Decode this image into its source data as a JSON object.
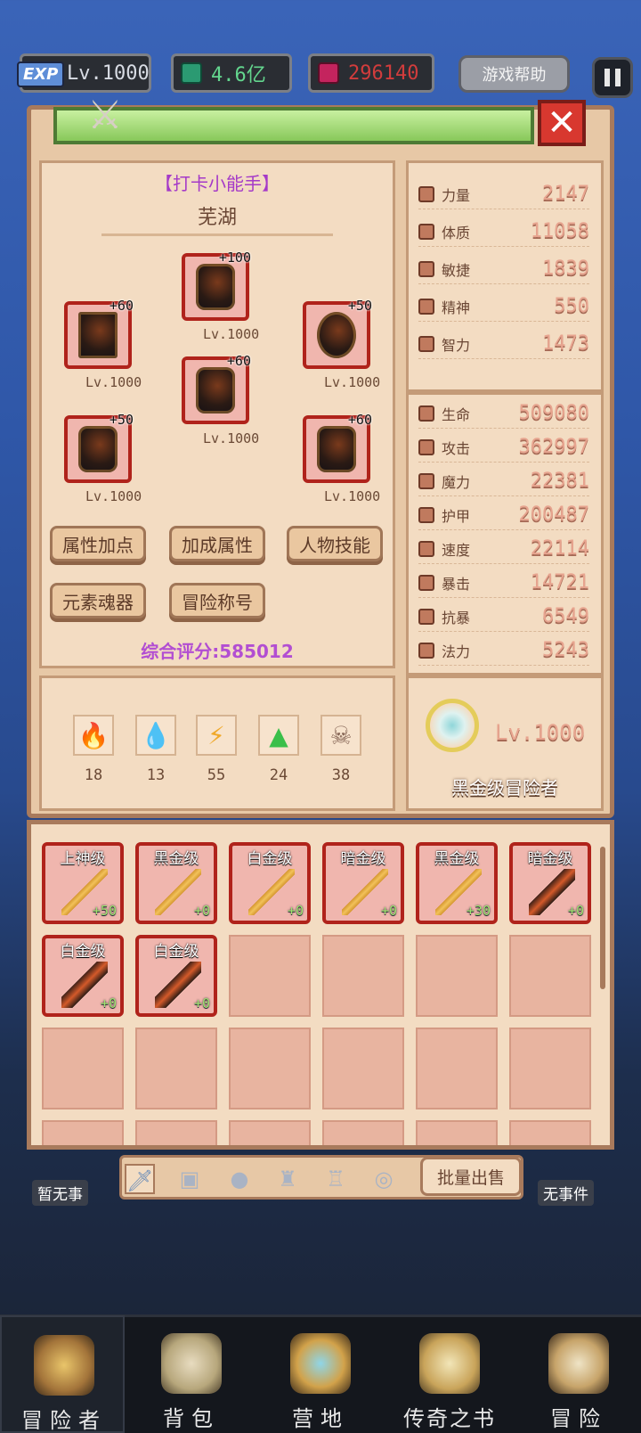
{
  "topbar": {
    "exp_badge": "EXP",
    "level": "Lv.1000",
    "currency1": "4.6亿",
    "currency2": "296140",
    "help_label": "游戏帮助"
  },
  "colors": {
    "accent_red": "#b0231b",
    "stat_value": "#e7a48f",
    "title_purple": "#a53ac8",
    "green_plus": "#9ee36f"
  },
  "player": {
    "title": "【打卡小能手】",
    "name": "芜湖",
    "score_label": "综合评分:585012"
  },
  "equipment": [
    {
      "plus": "+100",
      "level": "Lv.1000"
    },
    {
      "plus": "+60",
      "level": "Lv.1000"
    },
    {
      "plus": "+50",
      "level": "Lv.1000"
    },
    {
      "plus": "+60",
      "level": "Lv.1000"
    },
    {
      "plus": "+50",
      "level": "Lv.1000"
    },
    {
      "plus": "+60",
      "level": "Lv.1000"
    }
  ],
  "buttons": {
    "attr_points": "属性加点",
    "bonus_attr": "加成属性",
    "char_skill": "人物技能",
    "element_soul": "元素魂器",
    "adventure_title": "冒险称号"
  },
  "base_stats": [
    {
      "label": "力量",
      "value": "2147"
    },
    {
      "label": "体质",
      "value": "11058"
    },
    {
      "label": "敏捷",
      "value": "1839"
    },
    {
      "label": "精神",
      "value": "550"
    },
    {
      "label": "智力",
      "value": "1473"
    }
  ],
  "combat_stats": [
    {
      "label": "生命",
      "value": "509080"
    },
    {
      "label": "攻击",
      "value": "362997"
    },
    {
      "label": "魔力",
      "value": "22381"
    },
    {
      "label": "护甲",
      "value": "200487"
    },
    {
      "label": "速度",
      "value": "22114"
    },
    {
      "label": "暴击",
      "value": "14721"
    },
    {
      "label": "抗暴",
      "value": "6549"
    },
    {
      "label": "法力",
      "value": "5243"
    }
  ],
  "elements": [
    {
      "icon": "fire-icon",
      "count": "18"
    },
    {
      "icon": "water-icon",
      "count": "13"
    },
    {
      "icon": "lightning-icon",
      "count": "55"
    },
    {
      "icon": "earth-icon",
      "count": "24"
    },
    {
      "icon": "skull-icon",
      "count": "38"
    }
  ],
  "rank": {
    "level": "Lv.1000",
    "name": "黑金级冒险者"
  },
  "inventory": [
    {
      "grade": "上神级",
      "plus": "+50",
      "type": "gold"
    },
    {
      "grade": "黑金级",
      "plus": "+0",
      "type": "gold"
    },
    {
      "grade": "白金级",
      "plus": "+0",
      "type": "gold"
    },
    {
      "grade": "暗金级",
      "plus": "+0",
      "type": "gold"
    },
    {
      "grade": "黑金级",
      "plus": "+30",
      "type": "gold"
    },
    {
      "grade": "暗金级",
      "plus": "+0",
      "type": "dark"
    },
    {
      "grade": "白金级",
      "plus": "+0",
      "type": "dark"
    },
    {
      "grade": "白金级",
      "plus": "+0",
      "type": "dark"
    }
  ],
  "tabs": {
    "batch_sell": "批量出售"
  },
  "background_labels": {
    "left": "暂无事",
    "right": "无事件"
  },
  "nav": [
    {
      "label": "冒险者"
    },
    {
      "label": "背包"
    },
    {
      "label": "营地"
    },
    {
      "label": "传奇之书"
    },
    {
      "label": "冒险"
    }
  ]
}
